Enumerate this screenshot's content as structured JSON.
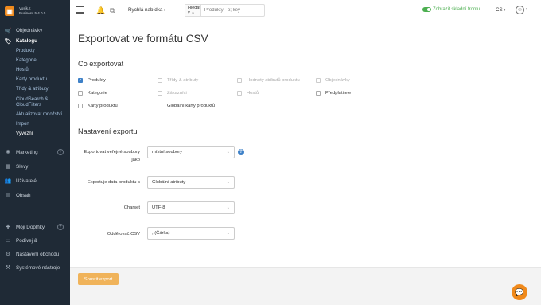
{
  "brand": {
    "line1": "Vosík.it",
    "line2": "Business 5.4.0.0"
  },
  "sidebar": {
    "items": [
      {
        "label": "Objednávky",
        "icon": "cart-icon"
      },
      {
        "label": "Katalogu",
        "icon": "tag-icon"
      },
      {
        "label": "Marketing",
        "icon": "gear-icon"
      },
      {
        "label": "Slevy",
        "icon": "cube-icon"
      },
      {
        "label": "Uživatelé",
        "icon": "users-icon"
      },
      {
        "label": "Obsah",
        "icon": "document-icon"
      },
      {
        "label": "Moji Doplňky",
        "icon": "puzzle-icon"
      },
      {
        "label": "Podívej &",
        "icon": "eye-icon"
      },
      {
        "label": "Nastavení obchodu",
        "icon": "settings-icon"
      },
      {
        "label": "Systémové nástroje",
        "icon": "tools-icon"
      }
    ],
    "catalog_sub": [
      "Produkty",
      "Kategorie",
      "Hostů",
      "Karty produktu",
      "Třídy & atributy",
      "CloudSearch & CloudFilters",
      "Aktualizovat množství",
      "Import",
      "Vývozní"
    ]
  },
  "topbar": {
    "quick_menu": "Rychlá nabídka ›",
    "search_type": "Hledat v ⌄",
    "search_placeholder": "Produkty - p; key",
    "store_toggle": "Zobrazit skladní frontu",
    "lang": "CS ›",
    "user_chevron": "›"
  },
  "page": {
    "title": "Exportovat ve formátu CSV",
    "section_export": "Co exportovat",
    "section_settings": "Nastavení exportu",
    "checkboxes": [
      {
        "label": "Produkty",
        "checked": true,
        "disabled": false
      },
      {
        "label": "Třídy & atributy",
        "checked": false,
        "disabled": true
      },
      {
        "label": "Hodnoty atributů produktu",
        "checked": false,
        "disabled": true
      },
      {
        "label": "Objednávky",
        "checked": false,
        "disabled": true
      },
      {
        "label": "Kategorie",
        "checked": false,
        "disabled": false
      },
      {
        "label": "Zákazníci",
        "checked": false,
        "disabled": true
      },
      {
        "label": "Hostů",
        "checked": false,
        "disabled": true
      },
      {
        "label": "Předplatitele",
        "checked": false,
        "disabled": false
      },
      {
        "label": "Karty produktu",
        "checked": false,
        "disabled": false
      },
      {
        "label": "Globální karty produktů",
        "checked": false,
        "disabled": false
      }
    ],
    "fields": [
      {
        "label": "Exportovat veřejné soubory jako",
        "value": "místní soubory"
      },
      {
        "label": "Exportuje data produktu s",
        "value": "Globální atributy"
      },
      {
        "label": "Charset",
        "value": "UTF-8"
      },
      {
        "label": "Oddělovač CSV",
        "value": ", (Čárka)"
      }
    ],
    "run_button": "Spustit export"
  },
  "colors": {
    "accent": "#3d80c7",
    "brand": "#f08a1c",
    "sidebar_bg": "#1f2a36",
    "run_button": "#f0b35a"
  }
}
